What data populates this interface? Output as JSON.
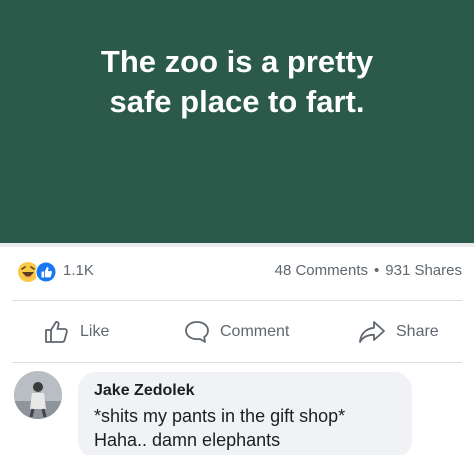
{
  "post": {
    "text": "The zoo is a pretty\nsafe place to fart.",
    "background_color": "#2b5a4a"
  },
  "reactions": {
    "icons": [
      "haha-icon",
      "like-icon"
    ],
    "count": "1.1K"
  },
  "stats": {
    "comments": "48 Comments",
    "separator": "•",
    "shares": "931 Shares"
  },
  "actions": {
    "like_label": "Like",
    "comment_label": "Comment",
    "share_label": "Share"
  },
  "comment": {
    "author": "Jake Zedolek",
    "lines": [
      "*shits my pants in the gift shop*",
      "Haha.. damn elephants"
    ]
  }
}
